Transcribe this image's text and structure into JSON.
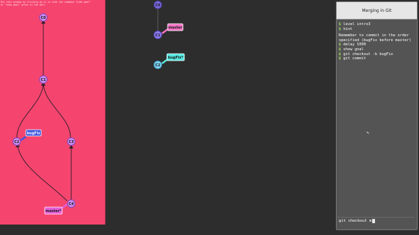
{
  "goal": {
    "hint_text": "Hit this window by clicking on it or with the command \"hide goal\"\nor \"show goal\" press in the hall",
    "commits": [
      {
        "id": "C0"
      },
      {
        "id": "C1"
      },
      {
        "id": "C2"
      },
      {
        "id": "C3"
      },
      {
        "id": "C4"
      }
    ],
    "branches": [
      {
        "name": "bugFix",
        "color": "#3d56e0"
      },
      {
        "name": "master*",
        "color": "#e35ed8"
      }
    ]
  },
  "main_graph": {
    "commits": [
      {
        "id": "C0"
      },
      {
        "id": "C1"
      },
      {
        "id": "C2"
      }
    ],
    "branches": [
      {
        "name": "master",
        "color": "#f272c4"
      },
      {
        "name": "bugFix*",
        "color": "#54e8e0"
      }
    ]
  },
  "terminal": {
    "title": "Merging in Git",
    "lines": [
      {
        "prompt": "$",
        "text": "level intro3"
      },
      {
        "prompt": "$",
        "text": "hint"
      },
      {
        "prompt": "",
        "text": ""
      },
      {
        "prompt": "",
        "text": "Remember to commit in the order specified (bugFix before master)"
      },
      {
        "prompt": "$",
        "text": "delay 1000"
      },
      {
        "prompt": "$",
        "text": "show goal"
      },
      {
        "prompt": "$",
        "text": "git checkout -b bugFix"
      },
      {
        "prompt": "$",
        "text": "git commit"
      }
    ],
    "input_value": "git checkout m"
  },
  "colors": {
    "goal_bg": "#f5456f",
    "main_bg": "#2d2d2d",
    "commit_fill": "#c98bf0",
    "commit_fill_head": "#8b7bf0",
    "commit_fill_c2": "#7fd0f0"
  }
}
